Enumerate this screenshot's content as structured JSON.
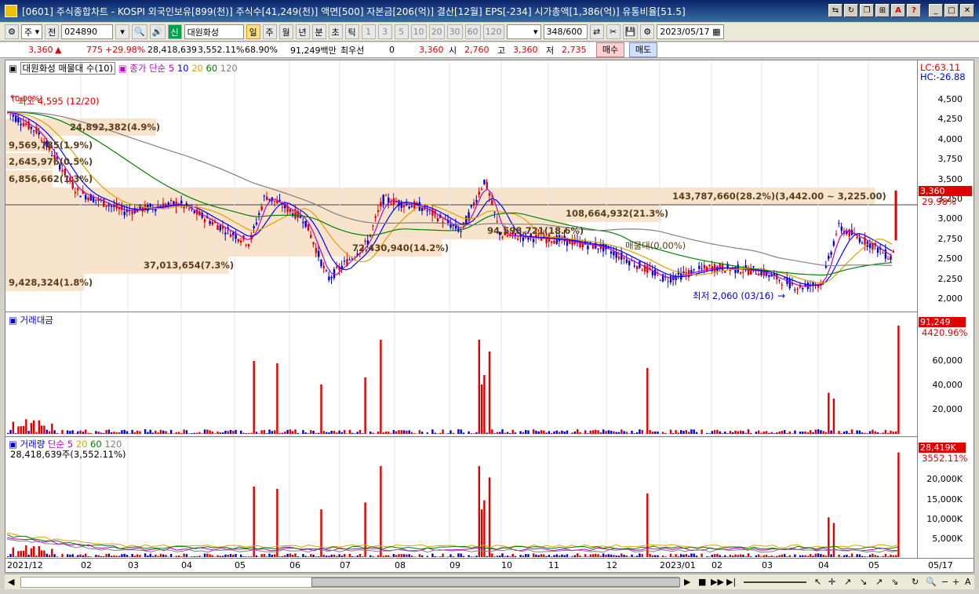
{
  "window": {
    "title": "[0601] 주식종합차트 - KOSPI 외국인보유[899(천)] 주식수[41,249(천)] 액면[500] 자본금[206(억)] 결산[12월] EPS[-234] 시가총액[1,386(억)] 유통비율[51.5]"
  },
  "toolbar": {
    "market": "주",
    "prefix": "전",
    "code": "024890",
    "badge": "신",
    "stock_name": "대원화성",
    "periods": [
      "일",
      "주",
      "월",
      "년",
      "분",
      "초",
      "틱"
    ],
    "active_period": "일",
    "intervals": [
      "1",
      "3",
      "5",
      "10",
      "20",
      "30",
      "60",
      "120"
    ],
    "count": "348",
    "count_total": "/600",
    "date": "2023/05/17"
  },
  "quote": {
    "price": "3,360",
    "change": "775",
    "rate": "+29.98%",
    "volume": "28,418,639",
    "volume_ratio": "3,552.11%",
    "turnover": "68.90%",
    "amount": "91,249백만",
    "pref_label": "최우선",
    "pref_value": "0",
    "ask": "3,360",
    "open_label": "시",
    "open": "2,760",
    "high_label": "고",
    "high": "3,360",
    "low_label": "저",
    "low": "2,735",
    "buy": "매수",
    "sell": "매도"
  },
  "price_panel": {
    "legend_title": "대원화성 매물대 수(10)",
    "ma_label": "종가 단순",
    "ma_periods": [
      "5",
      "10",
      "20",
      "60",
      "120"
    ],
    "lc": "LC:63.11",
    "hc": "HC:-26.88",
    "y_ticks": [
      "4,500",
      "4,250",
      "4,000",
      "3,750",
      "3,500",
      "3,250",
      "3,000",
      "2,750",
      "2,500",
      "2,250",
      "2,000"
    ],
    "current_tag": "3,360",
    "current_rate": "29.98%",
    "high_note": "최고 4,595 (12/20)",
    "low_note": "최저 2,060 (03/16)",
    "top_pct": "(0.00%)",
    "vol_profile": [
      "24,892,382(4.9%)",
      "9,569,785(1.9%)",
      "2,645,976(0.5%)",
      "6,856,662(1.3%)",
      "143,787,660(28.2%)(3,442.00 ~ 3,225.00)",
      "108,664,932(21.3%)",
      "94,598,721(18.6%)",
      "72,430,940(14.2%)",
      "37,013,654(7.3%)",
      "9,428,324(1.8%)",
      "매물대(0.00%)"
    ]
  },
  "amount_panel": {
    "legend": "거래대금",
    "y_ticks": [
      "60,000",
      "40,000",
      "20,000"
    ],
    "tag": "91,249",
    "tag_rate": "4420.96%"
  },
  "volume_panel": {
    "legend": "거래량",
    "ma_label": "단순",
    "ma_periods": [
      "5",
      "20",
      "60",
      "120"
    ],
    "current": "28,418,639주(3,552.11%)",
    "y_ticks": [
      "20,000K",
      "15,000K",
      "10,000K",
      "5,000K"
    ],
    "tag": "28,419K",
    "tag_rate": "3552.11%"
  },
  "x_axis": [
    "2021/12",
    "02",
    "03",
    "04",
    "05",
    "06",
    "07",
    "08",
    "09",
    "10",
    "11",
    "12",
    "2023/01",
    "02",
    "03",
    "04",
    "05"
  ],
  "x_end": "05/17",
  "colors": {
    "up": "#e00000",
    "down": "#0000d0",
    "ma5": "#c000c0",
    "ma10": "#0000ff",
    "ma20": "#e0a000",
    "ma60": "#008000",
    "ma120": "#808080"
  }
}
